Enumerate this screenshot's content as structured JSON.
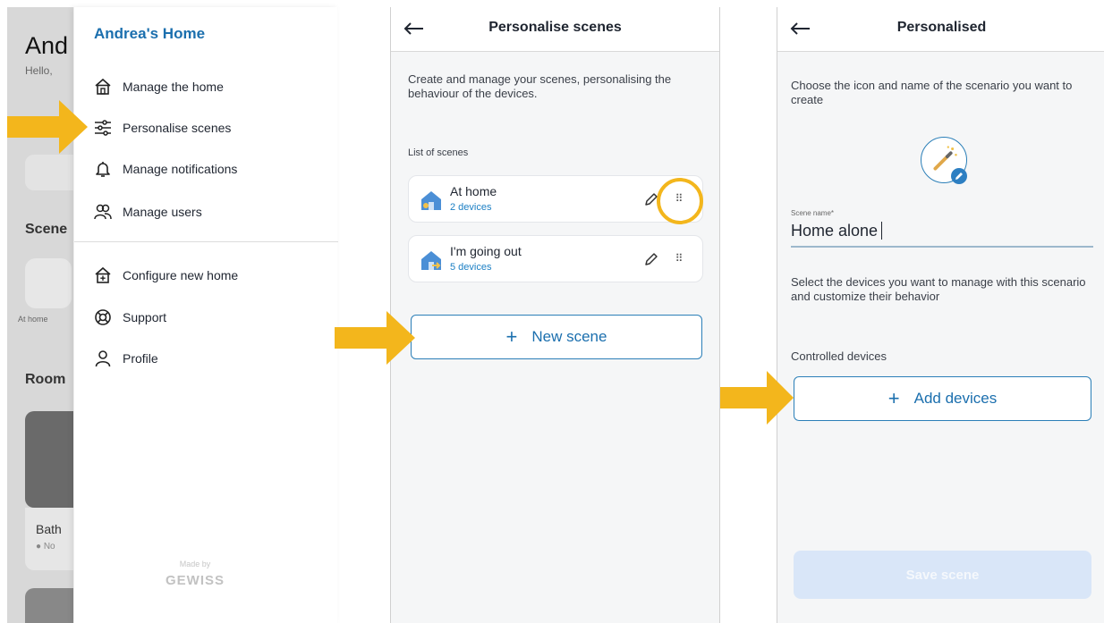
{
  "screen1": {
    "bg_title": "And",
    "bg_hello": "Hello,",
    "bg_scenes_heading": "Scene",
    "bg_scene_label": "At home",
    "bg_rooms_heading": "Room",
    "bg_room_name": "Bath",
    "bg_room_status": "● No",
    "drawer": {
      "home_name": "Andrea's Home",
      "items_top": [
        {
          "label": "Manage the home",
          "icon": "house-icon"
        },
        {
          "label": "Personalise scenes",
          "icon": "sliders-icon"
        },
        {
          "label": "Manage notifications",
          "icon": "bell-icon"
        },
        {
          "label": "Manage users",
          "icon": "users-icon"
        }
      ],
      "items_bottom": [
        {
          "label": "Configure new home",
          "icon": "house-plus-icon"
        },
        {
          "label": "Support",
          "icon": "lifebuoy-icon"
        },
        {
          "label": "Profile",
          "icon": "person-icon"
        }
      ],
      "made_by": "Made by",
      "brand": "GEWISS"
    }
  },
  "screen2": {
    "title": "Personalise scenes",
    "intro": "Create and manage your scenes, personalising the behaviour of the devices.",
    "list_label": "List of scenes",
    "scenes": [
      {
        "name": "At home",
        "count": "2 devices"
      },
      {
        "name": "I'm going out",
        "count": "5 devices"
      }
    ],
    "new_scene_label": "New scene",
    "plus": "+"
  },
  "screen3": {
    "title": "Personalised",
    "intro": "Choose the icon and name of the scenario you want to create",
    "field_label": "Scene name*",
    "field_value": "Home alone",
    "devices_intro": "Select the devices you want to manage with this scenario and customize their behavior",
    "controlled_label": "Controlled devices",
    "add_devices_label": "Add devices",
    "plus": "+",
    "save_label": "Save scene"
  },
  "colors": {
    "accent": "#1b6fae",
    "arrow": "#f3b61c",
    "save_disabled": "#d9e6f8"
  }
}
